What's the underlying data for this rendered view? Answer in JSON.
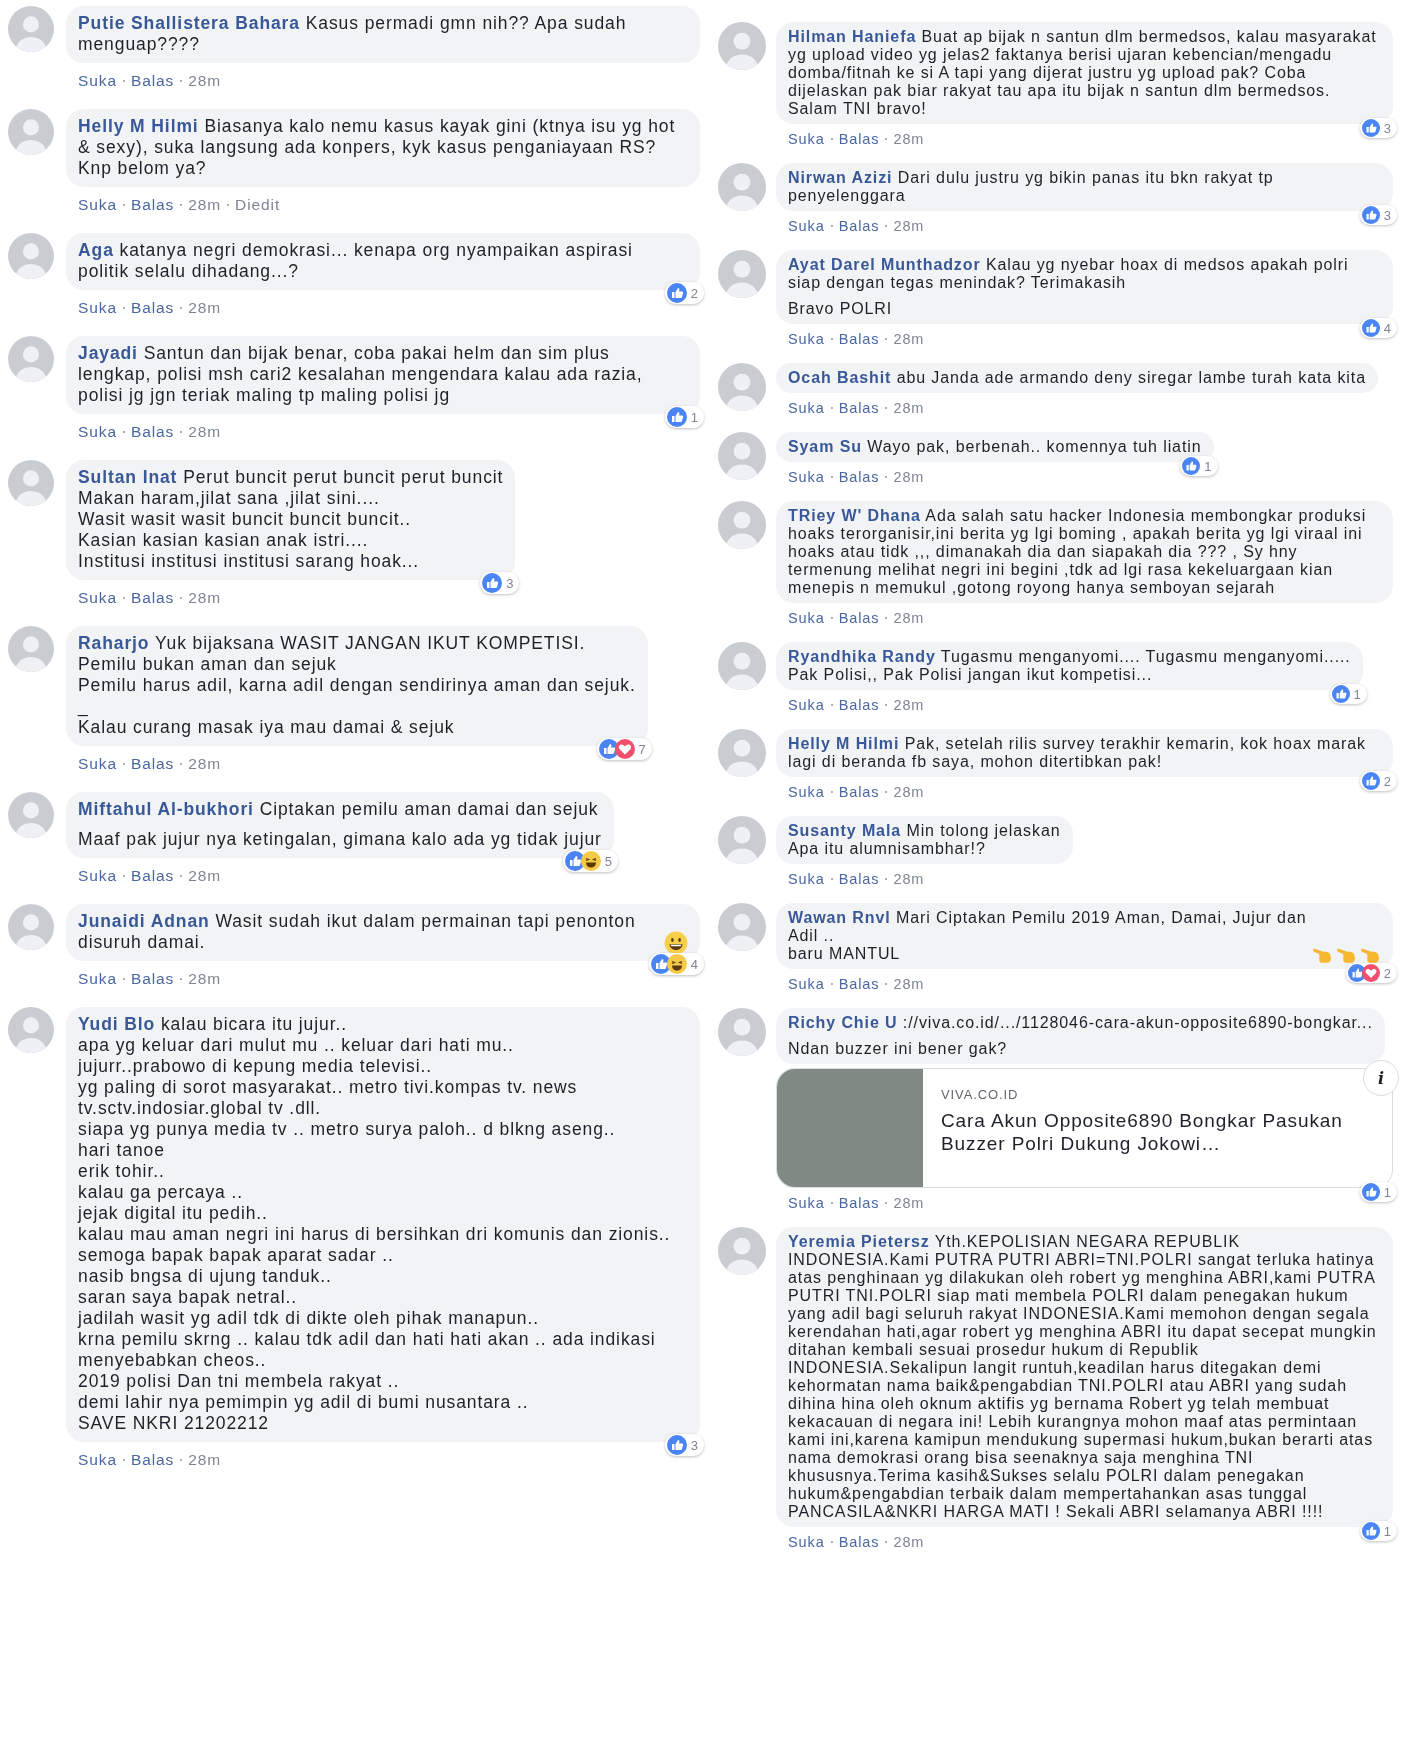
{
  "columns": [
    {
      "comments": [
        {
          "author": "Putie Shallistera Bahara",
          "paragraphs": [
            "Kasus permadi gmn nih?? Apa sudah menguap????"
          ],
          "actions": [
            "Suka",
            "Balas"
          ],
          "time": "28m"
        },
        {
          "author": "Helly M Hilmi",
          "paragraphs": [
            "Biasanya kalo nemu kasus kayak gini (ktnya isu yg hot & sexy), suka langsung ada konpers, kyk kasus penganiayaan RS?\nKnp belom ya?"
          ],
          "actions": [
            "Suka",
            "Balas"
          ],
          "time": "28m",
          "edited": "Diedit"
        },
        {
          "author": "Aga",
          "paragraphs": [
            "katanya negri demokrasi... kenapa org nyampaikan aspirasi politik selalu dihadang...?"
          ],
          "actions": [
            "Suka",
            "Balas"
          ],
          "time": "28m",
          "reactions": {
            "icons": [
              {
                "kind": "like"
              }
            ],
            "count": "2"
          }
        },
        {
          "author": "Jayadi",
          "paragraphs": [
            "Santun dan bijak benar, coba pakai helm dan sim plus lengkap, polisi msh cari2 kesalahan mengendara kalau ada razia, polisi jg jgn teriak maling tp maling polisi jg"
          ],
          "actions": [
            "Suka",
            "Balas"
          ],
          "time": "28m",
          "reactions": {
            "icons": [
              {
                "kind": "like"
              }
            ],
            "count": "1"
          }
        },
        {
          "author": "Sultan Inat",
          "paragraphs": [
            "Perut buncit perut buncit perut buncit\nMakan haram,jilat sana ,jilat sini....\nWasit wasit wasit buncit buncit buncit..\nKasian kasian kasian anak istri....\nInstitusi institusi institusi sarang hoak..."
          ],
          "actions": [
            "Suka",
            "Balas"
          ],
          "time": "28m",
          "reactions": {
            "icons": [
              {
                "kind": "like"
              }
            ],
            "count": "3"
          }
        },
        {
          "author": "Raharjo",
          "paragraphs": [
            "Yuk bijaksana WASIT JANGAN IKUT KOMPETISI.\nPemilu bukan aman dan sejuk\nPemilu harus adil, karna adil dengan sendirinya aman dan sejuk.\n_\nKalau curang masak iya mau damai & sejuk"
          ],
          "actions": [
            "Suka",
            "Balas"
          ],
          "time": "28m",
          "reactions": {
            "icons": [
              {
                "kind": "like"
              },
              {
                "kind": "love"
              }
            ],
            "count": "7"
          }
        },
        {
          "author": "Miftahul Al-bukhori",
          "paragraphs": [
            "Ciptakan pemilu aman damai dan sejuk",
            "Maaf pak jujur nya ketingalan, gimana kalo ada yg tidak jujur"
          ],
          "actions": [
            "Suka",
            "Balas"
          ],
          "time": "28m",
          "reactions": {
            "icons": [
              {
                "kind": "like"
              },
              {
                "kind": "haha"
              }
            ],
            "count": "5"
          }
        },
        {
          "author": "Junaidi Adnan",
          "paragraphs": [
            "Wasit sudah ikut dalam permainan tapi penonton disuruh damai."
          ],
          "emojis": [
            {
              "kind": "grin"
            }
          ],
          "actions": [
            "Suka",
            "Balas"
          ],
          "time": "28m",
          "reactions": {
            "icons": [
              {
                "kind": "like"
              },
              {
                "kind": "haha"
              }
            ],
            "count": "4"
          }
        },
        {
          "author": "Yudi Blo",
          "paragraphs": [
            "kalau bicara itu jujur..\napa yg keluar dari mulut mu .. keluar dari hati mu..\njujurr..prabowo di kepung media televisi..\nyg paling di sorot masyarakat.. metro tivi.kompas tv. news tv.sctv.indosiar.global tv .dll.\nsiapa yg punya media tv .. metro surya paloh.. d blkng aseng..\nhari tanoe\nerik tohir..\nkalau ga percaya ..\njejak digital itu pedih..\nkalau mau aman negri ini harus di bersihkan dri komunis dan zionis..\nsemoga bapak bapak aparat sadar ..\nnasib bngsa di ujung tanduk..\nsaran saya bapak netral..\njadilah wasit yg adil tdk di dikte oleh pihak manapun..\nkrna pemilu skrng .. kalau tdk adil dan hati hati akan .. ada indikasi menyebabkan cheos..\n2019 polisi Dan tni membela rakyat ..\ndemi lahir nya pemimpin yg adil di bumi nusantara ..\nSAVE NKRI 21202212"
          ],
          "actions": [
            "Suka",
            "Balas"
          ],
          "time": "28m",
          "reactions": {
            "icons": [
              {
                "kind": "like"
              }
            ],
            "count": "3"
          }
        }
      ]
    },
    {
      "comments": [
        {
          "author": "Hilman Haniefa",
          "paragraphs": [
            "Buat ap bijak n santun dlm bermedsos, kalau masyarakat yg upload video yg jelas2 faktanya berisi ujaran kebencian/mengadu domba/fitnah ke si A tapi yang dijerat justru yg upload pak? Coba dijelaskan pak biar rakyat tau apa itu bijak n santun dlm bermedsos. Salam TNI bravo!"
          ],
          "actions": [
            "Suka",
            "Balas"
          ],
          "time": "28m",
          "reactions": {
            "icons": [
              {
                "kind": "like"
              }
            ],
            "count": "3"
          }
        },
        {
          "author": "Nirwan Azizi",
          "paragraphs": [
            "Dari dulu justru yg bikin panas itu bkn rakyat tp penyelenggara"
          ],
          "actions": [
            "Suka",
            "Balas"
          ],
          "time": "28m",
          "reactions": {
            "icons": [
              {
                "kind": "like"
              }
            ],
            "count": "3"
          }
        },
        {
          "author": "Ayat Darel Munthadzor",
          "paragraphs": [
            "Kalau yg nyebar hoax di medsos apakah polri siap dengan tegas menindak? Terimakasih",
            "Bravo POLRI"
          ],
          "actions": [
            "Suka",
            "Balas"
          ],
          "time": "28m",
          "reactions": {
            "icons": [
              {
                "kind": "like"
              }
            ],
            "count": "4"
          }
        },
        {
          "author": "Ocah Bashit",
          "paragraphs": [
            "abu Janda ade armando deny siregar lambe turah kata kita"
          ],
          "actions": [
            "Suka",
            "Balas"
          ],
          "time": "28m"
        },
        {
          "author": "Syam Su",
          "paragraphs": [
            "Wayo pak, berbenah.. komennya tuh liatin"
          ],
          "actions": [
            "Suka",
            "Balas"
          ],
          "time": "28m",
          "reactions": {
            "icons": [
              {
                "kind": "like"
              }
            ],
            "count": "1"
          }
        },
        {
          "author": "TRiey W' Dhana",
          "paragraphs": [
            "Ada salah satu hacker Indonesia membongkar produksi hoaks terorganisir,ini berita yg lgi boming , apakah berita yg lgi viraal ini hoaks atau tidk ,,, dimanakah dia dan siapakah dia ??? , Sy hny termenung melihat negri ini begini ,tdk ad lgi rasa kekeluargaan kian menepis n memukul ,gotong royong hanya semboyan sejarah"
          ],
          "actions": [
            "Suka",
            "Balas"
          ],
          "time": "28m"
        },
        {
          "author": "Ryandhika Randy",
          "paragraphs": [
            "Tugasmu menganyomi.... Tugasmu menganyomi.....\nPak Polisi,, Pak Polisi jangan ikut kompetisi..."
          ],
          "actions": [
            "Suka",
            "Balas"
          ],
          "time": "28m",
          "reactions": {
            "icons": [
              {
                "kind": "like"
              }
            ],
            "count": "1"
          }
        },
        {
          "author": "Helly M Hilmi",
          "paragraphs": [
            "Pak, setelah rilis survey terakhir kemarin, kok hoax marak lagi di beranda fb saya, mohon ditertibkan pak!"
          ],
          "actions": [
            "Suka",
            "Balas"
          ],
          "time": "28m",
          "reactions": {
            "icons": [
              {
                "kind": "like"
              }
            ],
            "count": "2"
          }
        },
        {
          "author": "Susanty Mala",
          "paragraphs": [
            "Min tolong jelaskan\nApa itu alumnisambhar!?"
          ],
          "actions": [
            "Suka",
            "Balas"
          ],
          "time": "28m"
        },
        {
          "author": "Wawan Rnvl",
          "paragraphs": [
            "Mari Ciptakan Pemilu 2019 Aman, Damai, Jujur dan Adil ..\nbaru MANTUL"
          ],
          "emojis": [
            {
              "kind": "hand"
            },
            {
              "kind": "hand"
            },
            {
              "kind": "hand"
            }
          ],
          "actions": [
            "Suka",
            "Balas"
          ],
          "time": "28m",
          "reactions": {
            "icons": [
              {
                "kind": "like"
              },
              {
                "kind": "love"
              }
            ],
            "count": "2"
          }
        },
        {
          "author": "Richy Chie U",
          "paragraphs": [
            "://viva.co.id/.../1128046-cara-akun-opposite6890-bongkar...",
            "Ndan buzzer ini bener gak?"
          ],
          "link_preview": {
            "domain": "VIVA.CO.ID",
            "title": "Cara Akun Opposite6890 Bongkar Pasukan Buzzer Polri Dukung Jokowi…",
            "info": "i"
          },
          "actions": [
            "Suka",
            "Balas"
          ],
          "time": "28m",
          "reactions": {
            "icons": [
              {
                "kind": "like"
              }
            ],
            "count": "1"
          }
        },
        {
          "author": "Yeremia Pietersz",
          "paragraphs": [
            "Yth.KEPOLISIAN NEGARA REPUBLIK INDONESIA.Kami PUTRA PUTRI ABRI=TNI.POLRI sangat terluka hatinya atas penghinaan yg dilakukan oleh robert yg menghina ABRI,kami PUTRA PUTRI TNI.POLRI siap mati membela POLRI dalam penegakan hukum yang adil bagi seluruh rakyat INDONESIA.Kami memohon dengan segala kerendahan hati,agar robert yg menghina ABRI itu dapat secepat mungkin ditahan kembali sesuai prosedur hukum di Republik INDONESIA.Sekalipun langit runtuh,keadilan harus ditegakan demi kehormatan nama baik&pengabdian TNI.POLRI atau ABRI yang sudah dihina hina oleh oknum aktifis yg bernama Robert yg telah membuat kekacauan di negara ini! Lebih kurangnya mohon maaf atas permintaan kami ini,karena kamipun mendukung supermasi hukum,bukan berarti atas nama demokrasi orang bisa seenaknya saja menghina TNI khususnya.Terima kasih&Sukses selalu POLRI dalam penegakan hukum&pengabdian terbaik dalam mempertahankan asas tunggal PANCASILA&NKRI HARGA MATI ! Sekali ABRI selamanya ABRI !!!!"
          ],
          "actions": [
            "Suka",
            "Balas"
          ],
          "time": "28m",
          "reactions": {
            "icons": [
              {
                "kind": "like"
              }
            ],
            "count": "1"
          }
        }
      ]
    }
  ]
}
